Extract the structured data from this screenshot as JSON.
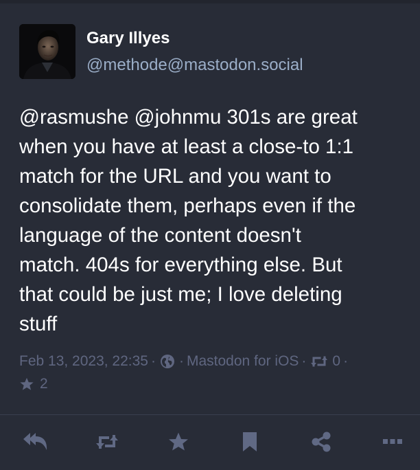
{
  "colors": {
    "background": "#282c37",
    "text_primary": "#ffffff",
    "handle": "#9baec8",
    "meta": "#5f6680",
    "action_icon": "#606984"
  },
  "post": {
    "author": {
      "display_name": "Gary Illyes",
      "handle": "@methode@mastodon.social",
      "avatar_icon": "profile-photo"
    },
    "content": "@rasmushe @johnmu 301s are great\nwhen you have at least a close-to 1:1\nmatch for the URL and you want to\nconsolidate them, perhaps even if the\nlanguage of the content doesn't\nmatch. 404s for everything else. But\nthat could be just me; I love deleting\nstuff",
    "meta": {
      "timestamp": "Feb 13, 2023, 22:35",
      "separator": "·",
      "visibility_icon": "globe-icon",
      "application": "Mastodon for iOS",
      "reblogs_icon": "retweet-icon",
      "reblogs_count": "0",
      "favourites_icon": "star-icon",
      "favourites_count": "2"
    }
  },
  "actions": [
    {
      "name": "reply-all",
      "icon": "reply-all-icon"
    },
    {
      "name": "boost",
      "icon": "retweet-icon"
    },
    {
      "name": "favourite",
      "icon": "star-icon"
    },
    {
      "name": "bookmark",
      "icon": "bookmark-icon"
    },
    {
      "name": "share",
      "icon": "share-icon"
    },
    {
      "name": "more",
      "icon": "ellipsis-icon"
    }
  ]
}
